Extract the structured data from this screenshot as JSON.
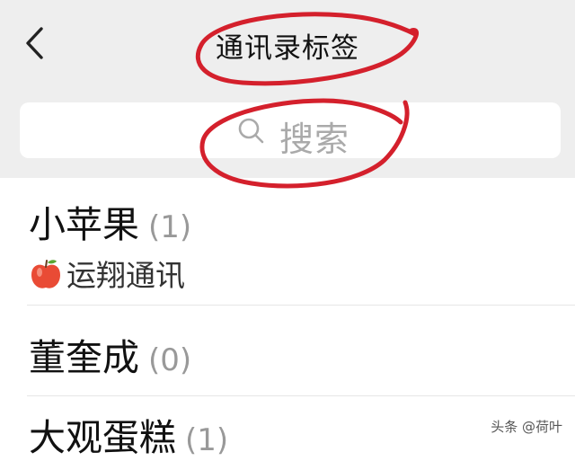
{
  "header": {
    "title": "通讯录标签",
    "back_icon": "chevron-left-icon"
  },
  "search": {
    "placeholder": "搜索",
    "icon": "search-icon"
  },
  "tags": [
    {
      "name": "小苹果",
      "count": "(1)",
      "members": "运翔通讯",
      "member_emoji": "apple"
    },
    {
      "name": "董奎成",
      "count": "(0)"
    },
    {
      "name": "大观蛋糕",
      "count": "(1)"
    }
  ],
  "watermark": "头条 @荷叶",
  "colors": {
    "header_bg": "#eeeeee",
    "annotation_red": "#d4202c"
  }
}
